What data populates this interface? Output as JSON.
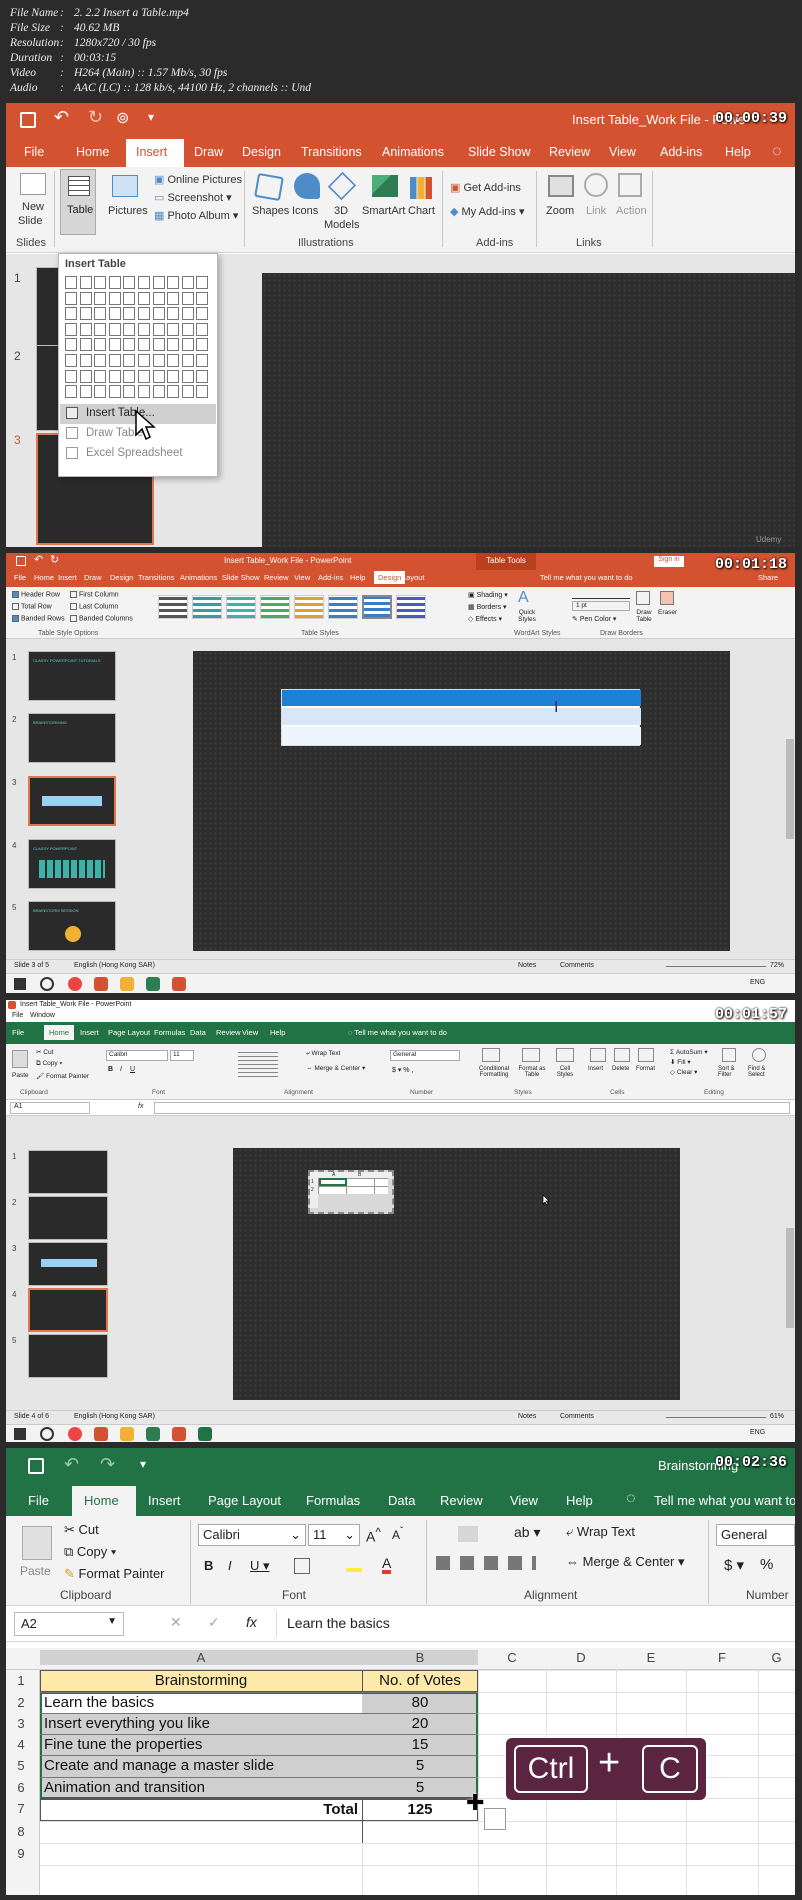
{
  "meta": {
    "rows": [
      {
        "key": "File Name",
        "value": "2. 2.2 Insert a Table.mp4"
      },
      {
        "key": "File Size",
        "value": "40.62 MB"
      },
      {
        "key": "Resolution",
        "value": "1280x720 / 30 fps"
      },
      {
        "key": "Duration",
        "value": "00:03:15"
      },
      {
        "key": "Video",
        "value": "H264 (Main) :: 1.57 Mb/s, 30 fps"
      },
      {
        "key": "Audio",
        "value": "AAC (LC) :: 128 kb/s, 44100 Hz, 2 channels :: Und"
      }
    ]
  },
  "f1": {
    "timestamp": "00:00:39",
    "title": "Insert Table_Work File  -  Powe",
    "tabs": [
      "File",
      "Home",
      "Insert",
      "Draw",
      "Design",
      "Transitions",
      "Animations",
      "Slide Show",
      "Review",
      "View",
      "Add-ins",
      "Help"
    ],
    "active_tab": "Insert",
    "ribbon": {
      "new_slide": [
        "New",
        "Slide"
      ],
      "table": "Table",
      "pictures": "Pictures",
      "online_pictures": "Online Pictures",
      "screenshot": "Screenshot",
      "photo_album": "Photo Album",
      "shapes": "Shapes",
      "icons": "Icons",
      "models": [
        "3D",
        "Models"
      ],
      "smartart": "SmartArt",
      "chart": "Chart",
      "get_addins": "Get Add-ins",
      "my_addins": "My Add-ins",
      "zoom": "Zoom",
      "link": "Link",
      "action": "Action",
      "groups": {
        "slides": "Slides",
        "illustrations": "Illustrations",
        "addins": "Add-ins",
        "links": "Links"
      }
    },
    "dropdown": {
      "title": "Insert Table",
      "items": [
        "Insert Table...",
        "Draw Table",
        "Excel Spreadsheet"
      ]
    },
    "slide_numbers": [
      "1",
      "2",
      "3"
    ],
    "watermark": "Udemy"
  },
  "f2": {
    "timestamp": "00:01:18",
    "title": "Insert Table_Work File  -  PowerPoint",
    "context": "Table Tools",
    "signin": "Sign in",
    "share": "Share",
    "tell_me": "Tell me what you want to do",
    "tabs": [
      "File",
      "Home",
      "Insert",
      "Draw",
      "Design",
      "Transitions",
      "Animations",
      "Slide Show",
      "Review",
      "View",
      "Add-ins",
      "Help",
      "Design",
      "Layout"
    ],
    "options": [
      "Header Row",
      "First Column",
      "Total Row",
      "Last Column",
      "Banded Rows",
      "Banded Columns"
    ],
    "groups": {
      "style_options": "Table Style Options",
      "styles": "Table Styles",
      "wordart": "WordArt Styles",
      "borders": "Draw Borders"
    },
    "fmt": {
      "shading": "Shading",
      "borders": "Borders",
      "effects": "Effects",
      "quick_styles": "Quick Styles",
      "pen_color": "Pen Color",
      "draw_table": "Draw Table",
      "eraser": "Eraser",
      "pen_weight": "1 pt"
    },
    "slide_numbers": [
      "1",
      "2",
      "3",
      "4",
      "5"
    ],
    "thumb_titles": [
      "CLASSY POWERPOINT TUTORIALS",
      "BRAINSTORMING",
      "",
      "CLASSY POWERPOINT",
      "BRAINSTORM SESSION"
    ],
    "status": {
      "left": "Slide 3 of 5",
      "lang": "English (Hong Kong SAR)",
      "notes": "Notes",
      "comments": "Comments",
      "zoom": "72%"
    },
    "tray": {
      "lang": "ENG"
    }
  },
  "f3": {
    "timestamp": "00:01:57",
    "title": "Insert Table_Work File - PowerPoint",
    "menu": [
      "File",
      "Window"
    ],
    "tabs": [
      "File",
      "Home",
      "Insert",
      "Page Layout",
      "Formulas",
      "Data",
      "Review",
      "View",
      "Help"
    ],
    "tell_me": "Tell me what you want to do",
    "ribbon": {
      "cut": "Cut",
      "copy": "Copy",
      "format_painter": "Format Painter",
      "paste": "Paste",
      "font": "Calibri",
      "size": "11",
      "wrap": "Wrap Text",
      "merge": "Merge & Center",
      "number": "General",
      "cond": "Conditional Formatting",
      "format_table": "Format as Table",
      "cell_styles": "Cell Styles",
      "insert": "Insert",
      "delete": "Delete",
      "format": "Format",
      "autosum": "AutoSum",
      "fill": "Fill",
      "clear": "Clear",
      "sort": "Sort & Filter",
      "find": "Find & Select"
    },
    "groups": [
      "Clipboard",
      "Font",
      "Alignment",
      "Number",
      "Styles",
      "Cells",
      "Editing"
    ],
    "namebox": "A1",
    "fx": "fx",
    "slide_numbers": [
      "1",
      "2",
      "3",
      "4",
      "5"
    ],
    "embedded": {
      "cols": [
        "A",
        "B"
      ],
      "rows": [
        "1",
        "2"
      ]
    },
    "status": {
      "left": "Slide 4 of 6",
      "lang": "English (Hong Kong SAR)",
      "notes": "Notes",
      "comments": "Comments",
      "zoom": "61%"
    },
    "tray": {
      "lang": "ENG"
    }
  },
  "f4": {
    "timestamp": "00:02:36",
    "title": "Brainstorming",
    "tabs": [
      "File",
      "Home",
      "Insert",
      "Page Layout",
      "Formulas",
      "Data",
      "Review",
      "View",
      "Help"
    ],
    "tell_me": "Tell me what you want to",
    "ribbon": {
      "paste": "Paste",
      "cut": "Cut",
      "copy": "Copy",
      "format_painter": "Format Painter",
      "font": "Calibri",
      "size": "11",
      "wrap": "Wrap Text",
      "merge": "Merge & Center",
      "number": "General",
      "currency": "$",
      "percent": "%"
    },
    "groups": {
      "clipboard": "Clipboard",
      "font": "Font",
      "alignment": "Alignment",
      "number": "Number"
    },
    "namebox": "A2",
    "fx": "fx",
    "formula": "Learn the basics",
    "columns": [
      "A",
      "B",
      "C",
      "D",
      "E",
      "F",
      "G"
    ],
    "rows": [
      "1",
      "2",
      "3",
      "4",
      "5",
      "6",
      "7",
      "8",
      "9"
    ],
    "header": {
      "a": "Brainstorming",
      "b": "No. of Votes"
    },
    "data": [
      {
        "a": "Learn the basics",
        "b": "80"
      },
      {
        "a": "Insert everything you like",
        "b": "20"
      },
      {
        "a": "Fine tune the properties",
        "b": "15"
      },
      {
        "a": "Create and manage a master slide",
        "b": "5"
      },
      {
        "a": "Animation and transition",
        "b": "5"
      }
    ],
    "total": {
      "label": "Total",
      "value": "125"
    },
    "shortcut": {
      "key1": "Ctrl",
      "plus": "+",
      "key2": "C"
    }
  }
}
